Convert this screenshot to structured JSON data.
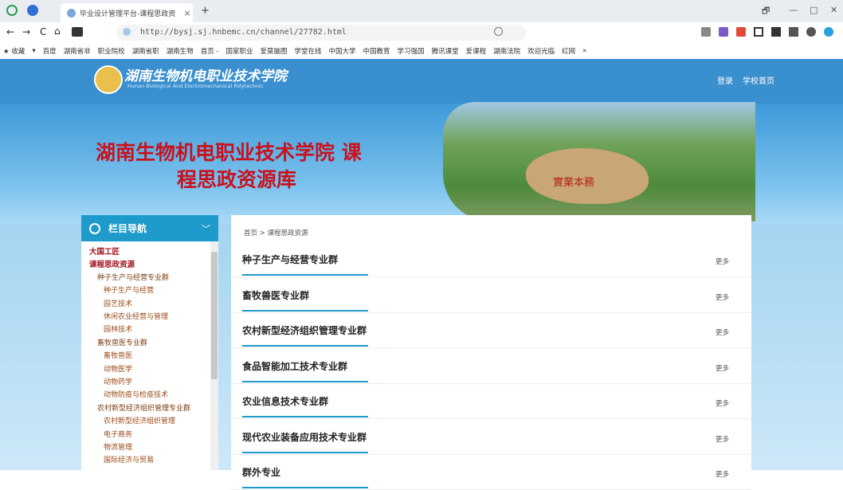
{
  "browser": {
    "tab_title": "毕业设计管理平台-课程思政资",
    "tab_close": "×",
    "new_tab": "+",
    "url": "http://bysj.sj.hnbemc.cn/channel/27782.html",
    "nav_buttons": [
      "←",
      "→",
      "C",
      "⌂"
    ],
    "window_controls": [
      "🗗",
      "—",
      "□",
      "✕"
    ],
    "bookmarks": [
      "★ 收藏",
      "▾",
      "百度",
      "湖南省非",
      "职业院校",
      "湖南省职",
      "湖南生物",
      "首页 -",
      "国家职业",
      "爱莫脑图",
      "学堂在线",
      "中国大学",
      "中国教育",
      "学习强国",
      "腾讯课堂",
      "爱课程",
      "湖南法院",
      "欢迎光临",
      "红网",
      "»"
    ]
  },
  "header": {
    "site_name": "湖南生物机电职业技术学院",
    "site_sub": "Hunan Biological And Electromechanical Polytechnic",
    "login": "登录",
    "school_home": "学校首页"
  },
  "banner": {
    "title_line1": "湖南生物机电职业技术学院 课",
    "title_line2": "程思政资源库",
    "rock_text": "實業本務"
  },
  "sidebar": {
    "title": "栏目导航",
    "items": [
      {
        "label": "大国工匠",
        "level": 0
      },
      {
        "label": "课程思政资源",
        "level": 0
      },
      {
        "label": "种子生产与经营专业群",
        "level": 1
      },
      {
        "label": "种子生产与经营",
        "level": 2
      },
      {
        "label": "园艺技术",
        "level": 2
      },
      {
        "label": "休闲农业经营与管理",
        "level": 2
      },
      {
        "label": "园林技术",
        "level": 2
      },
      {
        "label": "畜牧兽医专业群",
        "level": 1
      },
      {
        "label": "畜牧兽医",
        "level": 2
      },
      {
        "label": "动物医学",
        "level": 2
      },
      {
        "label": "动物药学",
        "level": 2
      },
      {
        "label": "动物防疫与检疫技术",
        "level": 2
      },
      {
        "label": "农村新型经济组织管理专业群",
        "level": 1
      },
      {
        "label": "农村新型经济组织管理",
        "level": 2
      },
      {
        "label": "电子商务",
        "level": 2
      },
      {
        "label": "物流管理",
        "level": 2
      },
      {
        "label": "国际经济与贸易",
        "level": 2
      }
    ]
  },
  "main": {
    "breadcrumb": "首页 > 课程思政资源",
    "more_label": "更多",
    "groups": [
      "种子生产与经营专业群",
      "畜牧兽医专业群",
      "农村新型经济组织管理专业群",
      "食品智能加工技术专业群",
      "农业信息技术专业群",
      "现代农业装备应用技术专业群",
      "群外专业"
    ]
  },
  "colors": {
    "accent": "#1e9bcb",
    "title_red": "#c8121e",
    "header_blue": "#3a8fcf"
  }
}
